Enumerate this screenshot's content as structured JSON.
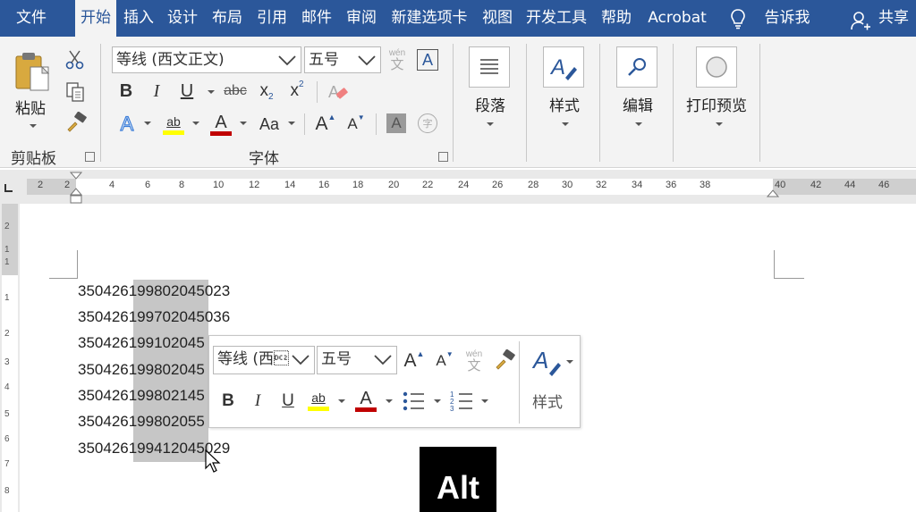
{
  "tabs": [
    {
      "label": "文件",
      "active": false
    },
    {
      "label": "开始",
      "active": true
    },
    {
      "label": "插入",
      "active": false
    },
    {
      "label": "设计",
      "active": false
    },
    {
      "label": "布局",
      "active": false
    },
    {
      "label": "引用",
      "active": false
    },
    {
      "label": "邮件",
      "active": false
    },
    {
      "label": "审阅",
      "active": false
    },
    {
      "label": "新建选项卡",
      "active": false
    },
    {
      "label": "视图",
      "active": false
    },
    {
      "label": "开发工具",
      "active": false
    },
    {
      "label": "帮助",
      "active": false
    },
    {
      "label": "Acrobat",
      "active": false
    }
  ],
  "tell_me": "告诉我",
  "share": "共享",
  "clipboard": {
    "paste_label": "粘贴",
    "group_label": "剪贴板"
  },
  "font": {
    "font_name": "等线 (西文正文)",
    "font_size": "五号",
    "group_label": "字体",
    "phonetic_top": "wén",
    "phonetic_char": "文",
    "char_border": "A",
    "bold": "B",
    "italic": "I",
    "underline": "U",
    "strike": "abc",
    "subscript_base": "x",
    "subscript": "2",
    "superscript_base": "x",
    "superscript": "2",
    "effects": "A",
    "highlight": "ab",
    "font_color": "A",
    "change_case": "Aa",
    "grow": "A",
    "shrink": "A",
    "char_shading": "A",
    "enclose": "字"
  },
  "ribbon_groups": {
    "paragraph": "段落",
    "styles": "样式",
    "editing": "编辑",
    "print_preview": "打印预览"
  },
  "ruler": {
    "top_numbers": [
      "2",
      "2",
      "2",
      "4",
      "6",
      "8",
      "10",
      "12",
      "14",
      "16",
      "18",
      "20",
      "22",
      "24",
      "26",
      "28",
      "30",
      "32",
      "34",
      "36",
      "38",
      "40",
      "42",
      "44",
      "46"
    ],
    "left_numbers": [
      "2",
      "1",
      "1",
      "1",
      "2",
      "3",
      "4",
      "5",
      "6",
      "7",
      "8"
    ]
  },
  "document": {
    "lines": [
      "350426199802045023",
      "350426199702045036",
      "350426199102045",
      "350426199802045",
      "350426199802145",
      "350426199802055",
      "350426199412045029"
    ]
  },
  "mini_toolbar": {
    "font_name": "等线 (西\u0012",
    "font_size": "五号",
    "styles_label": "样式"
  },
  "overlay": {
    "key": "Alt"
  },
  "colors": {
    "tab_bar": "#2b579a",
    "ribbon": "#f3f3f3",
    "highlight_yellow": "#ffff00",
    "font_red": "#c00000",
    "selection": "#c6c6c6"
  }
}
